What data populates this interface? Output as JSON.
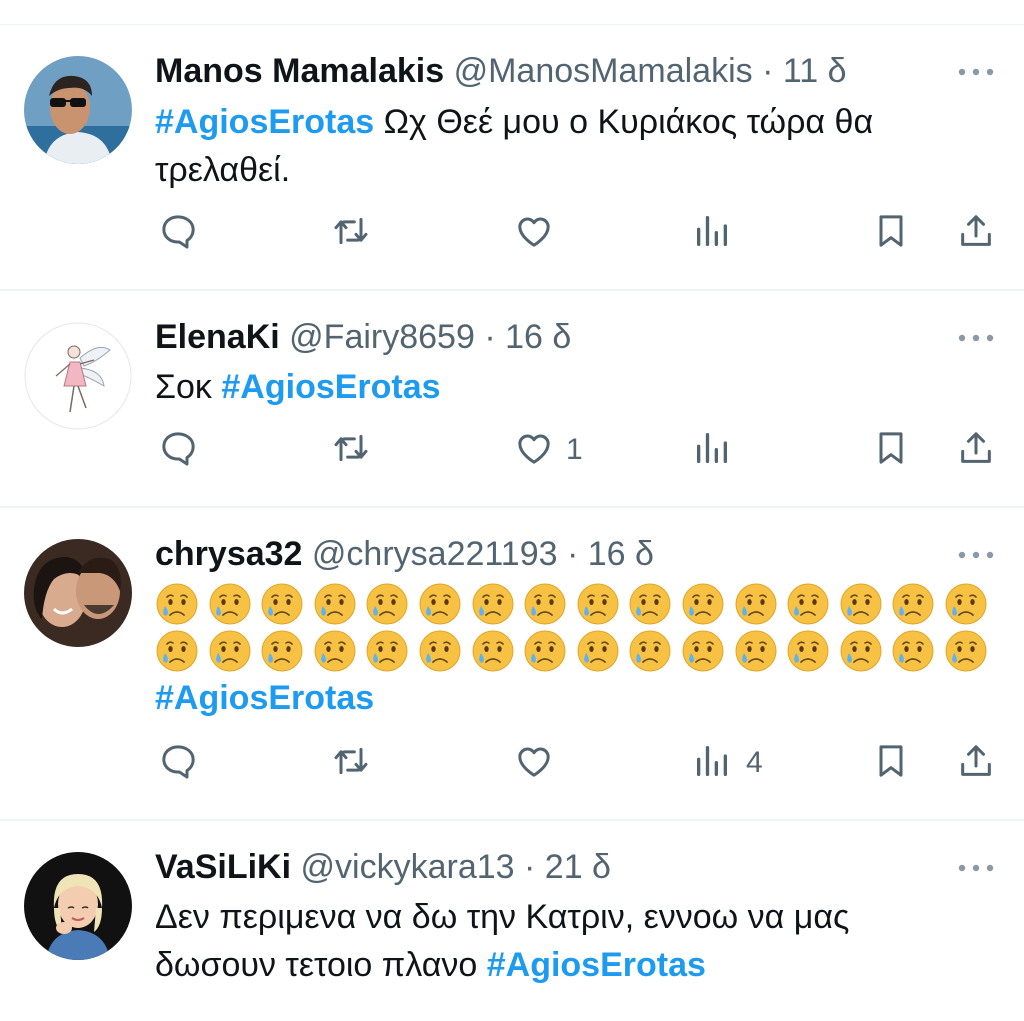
{
  "tweets": [
    {
      "name": "Manos Mamalakis",
      "handle": "@ManosMamalakis",
      "time": "11 δ",
      "hashtag": "#AgiosErotas",
      "text_line1": "Ωχ Θεέ μου ο Κυριάκος τώρα θα",
      "text_line2": "τρελαθεί.",
      "likes": "",
      "views": ""
    },
    {
      "name": "ElenaKi",
      "handle": "@Fairy8659",
      "time": "16 δ",
      "text_prefix": "Σοκ",
      "hashtag": "#AgiosErotas",
      "likes": "1",
      "views": ""
    },
    {
      "name": "chrysa32",
      "handle": "@chrysa221193",
      "time": "16 δ",
      "emoji_count": 32,
      "emoji_name": "crying-face-emoji",
      "hashtag": "#AgiosErotas",
      "likes": "",
      "views": "4"
    },
    {
      "name": "VaSiLiKi",
      "handle": "@vickykara13",
      "time": "21 δ",
      "text_line1": "Δεν περιμενα να δω την Κατριν, εννοω να μας",
      "text_line2_prefix": "δωσουν τετοιο πλανο",
      "hashtag": "#AgiosErotas"
    }
  ],
  "separator": "·",
  "icons": [
    "reply-icon",
    "retweet-icon",
    "like-icon",
    "views-icon",
    "bookmark-icon",
    "share-icon",
    "more-icon"
  ],
  "colors": {
    "hashtag": "#1d9bf0",
    "text": "#0f1419",
    "secondary": "#536471",
    "divider": "#eff3f4"
  }
}
